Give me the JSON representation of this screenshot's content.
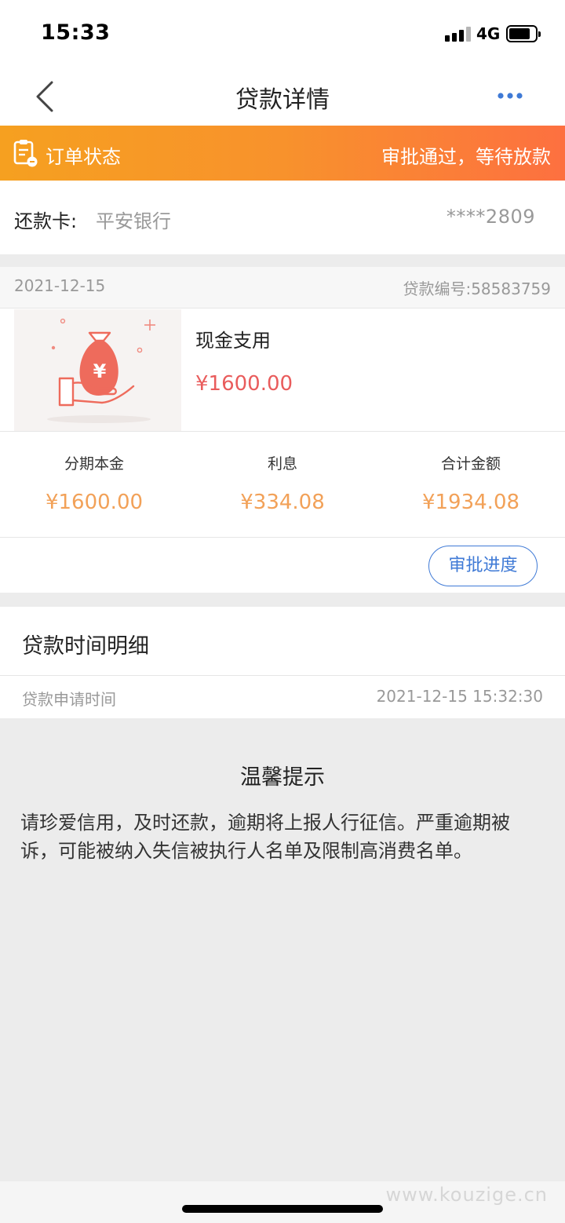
{
  "status_bar": {
    "time": "15:33",
    "network": "4G"
  },
  "nav": {
    "title": "贷款详情"
  },
  "order_status": {
    "label": "订单状态",
    "value": "审批通过，等待放款"
  },
  "repay_card": {
    "label": "还款卡:",
    "bank": "平安银行",
    "number": "****2809"
  },
  "loan": {
    "date": "2021-12-15",
    "number_text": "贷款编号:58583759",
    "product_name": "现金支用",
    "product_amount": "¥1600.00",
    "summary": [
      {
        "label": "分期本金",
        "value": "¥1600.00"
      },
      {
        "label": "利息",
        "value": "¥334.08"
      },
      {
        "label": "合计金额",
        "value": "¥1934.08"
      }
    ],
    "progress_button": "审批进度"
  },
  "time_detail": {
    "title": "贷款时间明细",
    "apply_label": "贷款申请时间",
    "apply_time": "2021-12-15 15:32:30"
  },
  "tips": {
    "title": "温馨提示",
    "text": "请珍爱信用，及时还款，逾期将上报人行征信。严重逾期被诉，可能被纳入失信被执行人名单及限制高消费名单。"
  },
  "watermark": "www.kouzige.cn",
  "icons": {
    "back": "chevron-left-icon",
    "more": "more-dots-icon",
    "order": "clipboard-icon",
    "product": "money-bag-hand-icon"
  },
  "colors": {
    "banner_start": "#f6a020",
    "banner_end": "#fd7040",
    "amount_red": "#e95c5c",
    "summary_orange": "#f2a158",
    "accent_blue": "#3f7ad6"
  }
}
